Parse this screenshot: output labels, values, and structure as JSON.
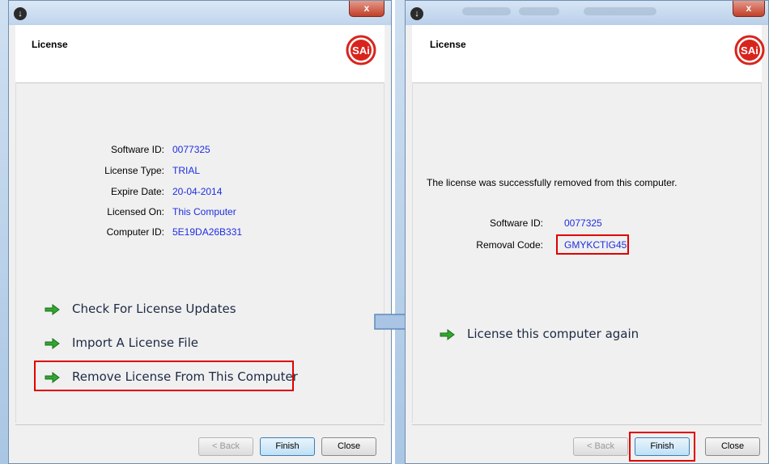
{
  "left_window": {
    "title_icon": "download-icon",
    "close_label": "x",
    "header_title": "License",
    "logo_text": "SAi",
    "info": [
      {
        "label": "Software ID:",
        "value": "0077325"
      },
      {
        "label": "License Type:",
        "value": "TRIAL"
      },
      {
        "label": "Expire Date:",
        "value": "20-04-2014"
      },
      {
        "label": "Licensed On:",
        "value": "This Computer"
      },
      {
        "label": "Computer ID:",
        "value": "5E19DA26B331"
      }
    ],
    "actions": [
      {
        "label": "Check For License Updates",
        "icon": "green-arrow-icon"
      },
      {
        "label": "Import A License File",
        "icon": "green-arrow-icon"
      },
      {
        "label": "Remove License From This Computer",
        "icon": "green-arrow-icon"
      }
    ],
    "buttons": {
      "back": "< Back",
      "finish": "Finish",
      "close": "Close"
    }
  },
  "right_window": {
    "title_icon": "download-icon",
    "close_label": "x",
    "header_title": "License",
    "logo_text": "SAi",
    "message": "The license was successfully removed from this computer.",
    "info": [
      {
        "label": "Software ID:",
        "value": "0077325"
      },
      {
        "label": "Removal Code:",
        "value": "GMYKCTIG45"
      }
    ],
    "actions": [
      {
        "label": "License this computer again",
        "icon": "green-arrow-icon"
      }
    ],
    "buttons": {
      "back": "< Back",
      "finish": "Finish",
      "close": "Close"
    }
  },
  "colors": {
    "value_text": "#1e2ee0",
    "highlight": "#e00000",
    "logo_red": "#d8241c"
  }
}
